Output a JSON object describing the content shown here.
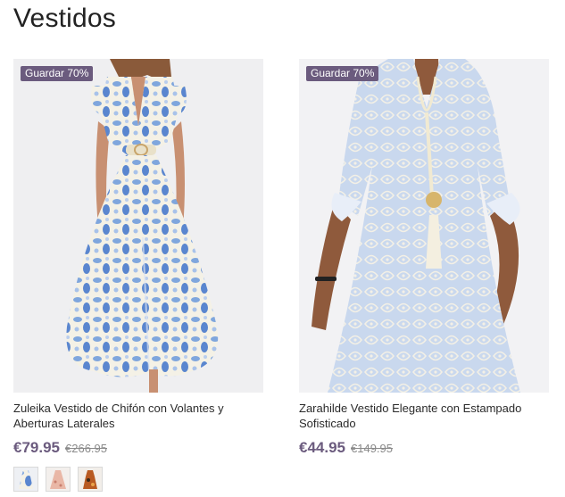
{
  "page": {
    "title": "Vestidos"
  },
  "products": [
    {
      "badge": "Guardar 70%",
      "name": "Zuleika Vestido de Chifón con Volantes y Aberturas Laterales",
      "price": "€79.95",
      "old_price": "€266.95",
      "image_icon": "blue-floral-maxi-dress-image",
      "swatches": [
        {
          "icon": "blue-floral-swatch"
        },
        {
          "icon": "pink-floral-swatch"
        },
        {
          "icon": "orange-print-swatch"
        }
      ]
    },
    {
      "badge": "Guardar 70%",
      "name": "Zarahilde Vestido Elegante con Estampado Sofisticado",
      "price": "€44.95",
      "old_price": "€149.95",
      "image_icon": "blue-paisley-midi-dress-image"
    }
  ],
  "colors": {
    "accent": "#6b5b7e",
    "image_bg": "#efeff1",
    "text": "#2b2b2b",
    "muted": "#8a8a8a"
  }
}
